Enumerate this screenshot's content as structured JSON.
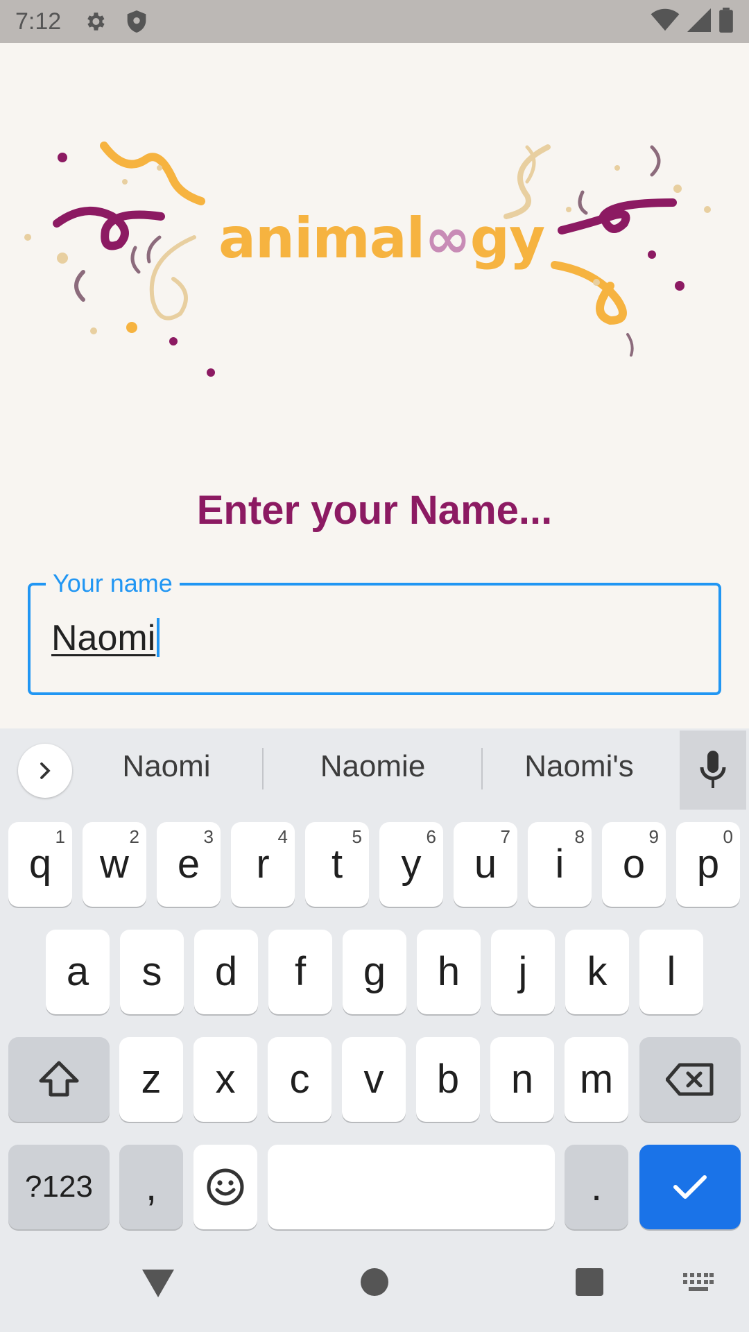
{
  "status_bar": {
    "time": "7:12",
    "icons_left": [
      "gear-icon",
      "shield-icon"
    ],
    "icons_right": [
      "wifi-icon",
      "cell-signal-icon",
      "battery-icon"
    ]
  },
  "app": {
    "logo_text_a": "animal",
    "logo_text_b": "gy",
    "title": "Enter your Name...",
    "name_field": {
      "label": "Your name",
      "value": "Naomi"
    }
  },
  "keyboard": {
    "suggestions": [
      "Naomi",
      "Naomie",
      "Naomi's"
    ],
    "row1": [
      {
        "k": "q",
        "h": "1"
      },
      {
        "k": "w",
        "h": "2"
      },
      {
        "k": "e",
        "h": "3"
      },
      {
        "k": "r",
        "h": "4"
      },
      {
        "k": "t",
        "h": "5"
      },
      {
        "k": "y",
        "h": "6"
      },
      {
        "k": "u",
        "h": "7"
      },
      {
        "k": "i",
        "h": "8"
      },
      {
        "k": "o",
        "h": "9"
      },
      {
        "k": "p",
        "h": "0"
      }
    ],
    "row2": [
      "a",
      "s",
      "d",
      "f",
      "g",
      "h",
      "j",
      "k",
      "l"
    ],
    "row3": [
      "z",
      "x",
      "c",
      "v",
      "b",
      "n",
      "m"
    ],
    "symbols_label": "?123",
    "comma_label": ",",
    "period_label": ".",
    "accent_color": "#1a73e8"
  },
  "colors": {
    "title": "#8c1a62",
    "field_border": "#2196f3",
    "logo_orange": "#f6b340",
    "logo_purple": "#8c1a62"
  }
}
